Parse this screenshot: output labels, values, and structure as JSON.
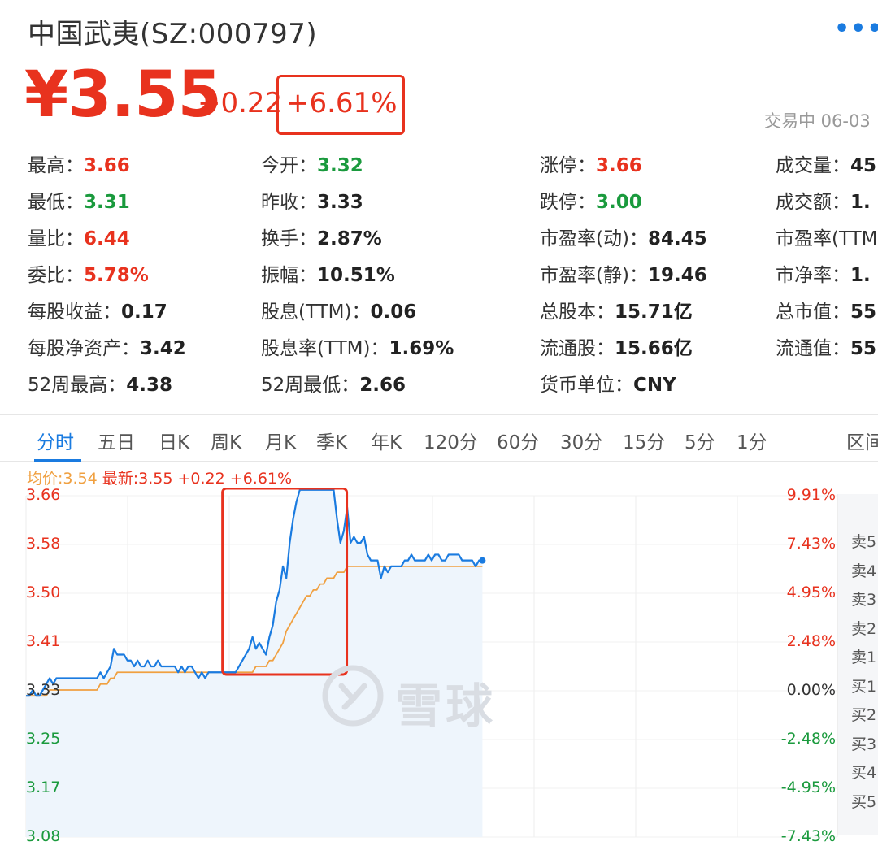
{
  "header": {
    "title": "中国武夷(SZ:000797)",
    "more_icon": "more-icon",
    "price": "¥3.55",
    "change": "+0.22",
    "change_pct": "+6.61%",
    "status": "交易中 06-03"
  },
  "stats": [
    {
      "label": "最高：",
      "value": "3.66",
      "color": "red"
    },
    {
      "label": "今开：",
      "value": "3.32",
      "color": "green"
    },
    {
      "label": "涨停：",
      "value": "3.66",
      "color": "red"
    },
    {
      "label": "成交量：",
      "value": "45",
      "color": "dark"
    },
    {
      "label": "最低：",
      "value": "3.31",
      "color": "green"
    },
    {
      "label": "昨收：",
      "value": "3.33",
      "color": "dark"
    },
    {
      "label": "跌停：",
      "value": "3.00",
      "color": "green"
    },
    {
      "label": "成交额：",
      "value": "1.",
      "color": "dark"
    },
    {
      "label": "量比：",
      "value": "6.44",
      "color": "red"
    },
    {
      "label": "换手：",
      "value": "2.87%",
      "color": "dark"
    },
    {
      "label": "市盈率(动)：",
      "value": "84.45",
      "color": "dark"
    },
    {
      "label": "市盈率(TTM",
      "value": "",
      "color": "dark"
    },
    {
      "label": "委比：",
      "value": "5.78%",
      "color": "red"
    },
    {
      "label": "振幅：",
      "value": "10.51%",
      "color": "dark"
    },
    {
      "label": "市盈率(静)：",
      "value": "19.46",
      "color": "dark"
    },
    {
      "label": "市净率：",
      "value": "1.",
      "color": "dark"
    },
    {
      "label": "每股收益：",
      "value": "0.17",
      "color": "dark"
    },
    {
      "label": "股息(TTM)：",
      "value": "0.06",
      "color": "dark"
    },
    {
      "label": "总股本：",
      "value": "15.71亿",
      "color": "dark"
    },
    {
      "label": "总市值：",
      "value": "55",
      "color": "dark"
    },
    {
      "label": "每股净资产：",
      "value": "3.42",
      "color": "dark"
    },
    {
      "label": "股息率(TTM)：",
      "value": "1.69%",
      "color": "dark"
    },
    {
      "label": "流通股：",
      "value": "15.66亿",
      "color": "dark"
    },
    {
      "label": "流通值：",
      "value": "55",
      "color": "dark"
    },
    {
      "label": "52周最高：",
      "value": "4.38",
      "color": "dark"
    },
    {
      "label": "52周最低：",
      "value": "2.66",
      "color": "dark"
    },
    {
      "label": "货币单位：",
      "value": "CNY",
      "color": "dark"
    }
  ],
  "tabs": [
    "分时",
    "五日",
    "日K",
    "周K",
    "月K",
    "季K",
    "年K",
    "120分",
    "60分",
    "30分",
    "15分",
    "5分",
    "1分",
    "区间"
  ],
  "active_tab": "分时",
  "legend": {
    "avg": "均价:3.54",
    "latest": "最新:3.55 +0.22 +6.61%"
  },
  "colors": {
    "up": "#e8321e",
    "down": "#1a9a3d",
    "price_line": "#1a7be0",
    "avg_line": "#f0a040",
    "fill": "#eef5fc"
  },
  "watermark": {
    "icon": "xueqiu-logo-icon",
    "text": "雪球"
  },
  "order_book": [
    "卖5",
    "卖4",
    "卖3",
    "卖2",
    "卖1",
    "买1",
    "买2",
    "买3",
    "买4",
    "买5"
  ],
  "chart_data": {
    "type": "line",
    "prev_close": 3.33,
    "ylim": [
      3.08,
      3.66
    ],
    "y_ticks_left": [
      "3.66",
      "3.58",
      "3.50",
      "3.41",
      "3.33",
      "3.25",
      "3.17",
      "3.08"
    ],
    "y_ticks_right": [
      "9.91%",
      "7.43%",
      "4.95%",
      "2.48%",
      "0.00%",
      "-2.48%",
      "-4.95%",
      "-7.43%"
    ],
    "sessions": 240,
    "series": [
      {
        "name": "最新",
        "values": [
          3.32,
          3.32,
          3.33,
          3.32,
          3.32,
          3.33,
          3.34,
          3.35,
          3.34,
          3.35,
          3.35,
          3.35,
          3.35,
          3.35,
          3.35,
          3.35,
          3.35,
          3.35,
          3.35,
          3.35,
          3.35,
          3.35,
          3.36,
          3.35,
          3.36,
          3.37,
          3.4,
          3.39,
          3.39,
          3.39,
          3.38,
          3.38,
          3.37,
          3.38,
          3.37,
          3.37,
          3.38,
          3.37,
          3.37,
          3.38,
          3.37,
          3.37,
          3.37,
          3.37,
          3.37,
          3.36,
          3.37,
          3.36,
          3.37,
          3.37,
          3.36,
          3.35,
          3.36,
          3.35,
          3.36,
          3.36,
          3.36,
          3.36,
          3.36,
          3.36,
          3.36,
          3.36,
          3.36,
          3.37,
          3.38,
          3.39,
          3.4,
          3.42,
          3.4,
          3.41,
          3.4,
          3.39,
          3.42,
          3.44,
          3.48,
          3.5,
          3.54,
          3.52,
          3.58,
          3.62,
          3.65,
          3.67,
          3.67,
          3.67,
          3.67,
          3.67,
          3.67,
          3.67,
          3.67,
          3.67,
          3.67,
          3.67,
          3.62,
          3.58,
          3.6,
          3.64,
          3.58,
          3.59,
          3.58,
          3.58,
          3.59,
          3.56,
          3.55,
          3.55,
          3.55,
          3.52,
          3.54,
          3.53,
          3.54,
          3.54,
          3.54,
          3.54,
          3.55,
          3.55,
          3.56,
          3.55,
          3.55,
          3.55,
          3.55,
          3.56,
          3.55,
          3.56,
          3.56,
          3.55,
          3.55,
          3.56,
          3.56,
          3.56,
          3.56,
          3.55,
          3.55,
          3.55,
          3.55,
          3.54,
          3.55,
          3.55
        ]
      },
      {
        "name": "均价",
        "values": [
          3.32,
          3.32,
          3.32,
          3.32,
          3.32,
          3.32,
          3.32,
          3.33,
          3.33,
          3.33,
          3.33,
          3.33,
          3.33,
          3.33,
          3.33,
          3.33,
          3.33,
          3.33,
          3.33,
          3.33,
          3.33,
          3.33,
          3.34,
          3.34,
          3.34,
          3.35,
          3.35,
          3.36,
          3.36,
          3.36,
          3.36,
          3.36,
          3.36,
          3.36,
          3.36,
          3.36,
          3.36,
          3.36,
          3.36,
          3.36,
          3.36,
          3.36,
          3.36,
          3.36,
          3.36,
          3.36,
          3.36,
          3.36,
          3.36,
          3.36,
          3.36,
          3.36,
          3.36,
          3.36,
          3.36,
          3.36,
          3.36,
          3.36,
          3.36,
          3.36,
          3.36,
          3.36,
          3.36,
          3.36,
          3.36,
          3.36,
          3.36,
          3.36,
          3.37,
          3.37,
          3.37,
          3.37,
          3.38,
          3.38,
          3.39,
          3.4,
          3.41,
          3.43,
          3.44,
          3.45,
          3.46,
          3.47,
          3.48,
          3.49,
          3.49,
          3.5,
          3.5,
          3.51,
          3.51,
          3.52,
          3.52,
          3.52,
          3.53,
          3.53,
          3.53,
          3.54,
          3.54,
          3.54,
          3.54,
          3.54,
          3.54,
          3.54,
          3.54,
          3.54,
          3.54,
          3.54,
          3.54,
          3.54,
          3.54,
          3.54,
          3.54,
          3.54,
          3.54,
          3.54,
          3.54,
          3.54,
          3.54,
          3.54,
          3.54,
          3.54,
          3.54,
          3.54,
          3.54,
          3.54,
          3.54,
          3.54,
          3.54,
          3.54,
          3.54,
          3.54,
          3.54,
          3.54,
          3.54,
          3.54,
          3.54,
          3.54
        ]
      }
    ],
    "highlight": {
      "from_index": 61,
      "to_index": 92
    }
  }
}
